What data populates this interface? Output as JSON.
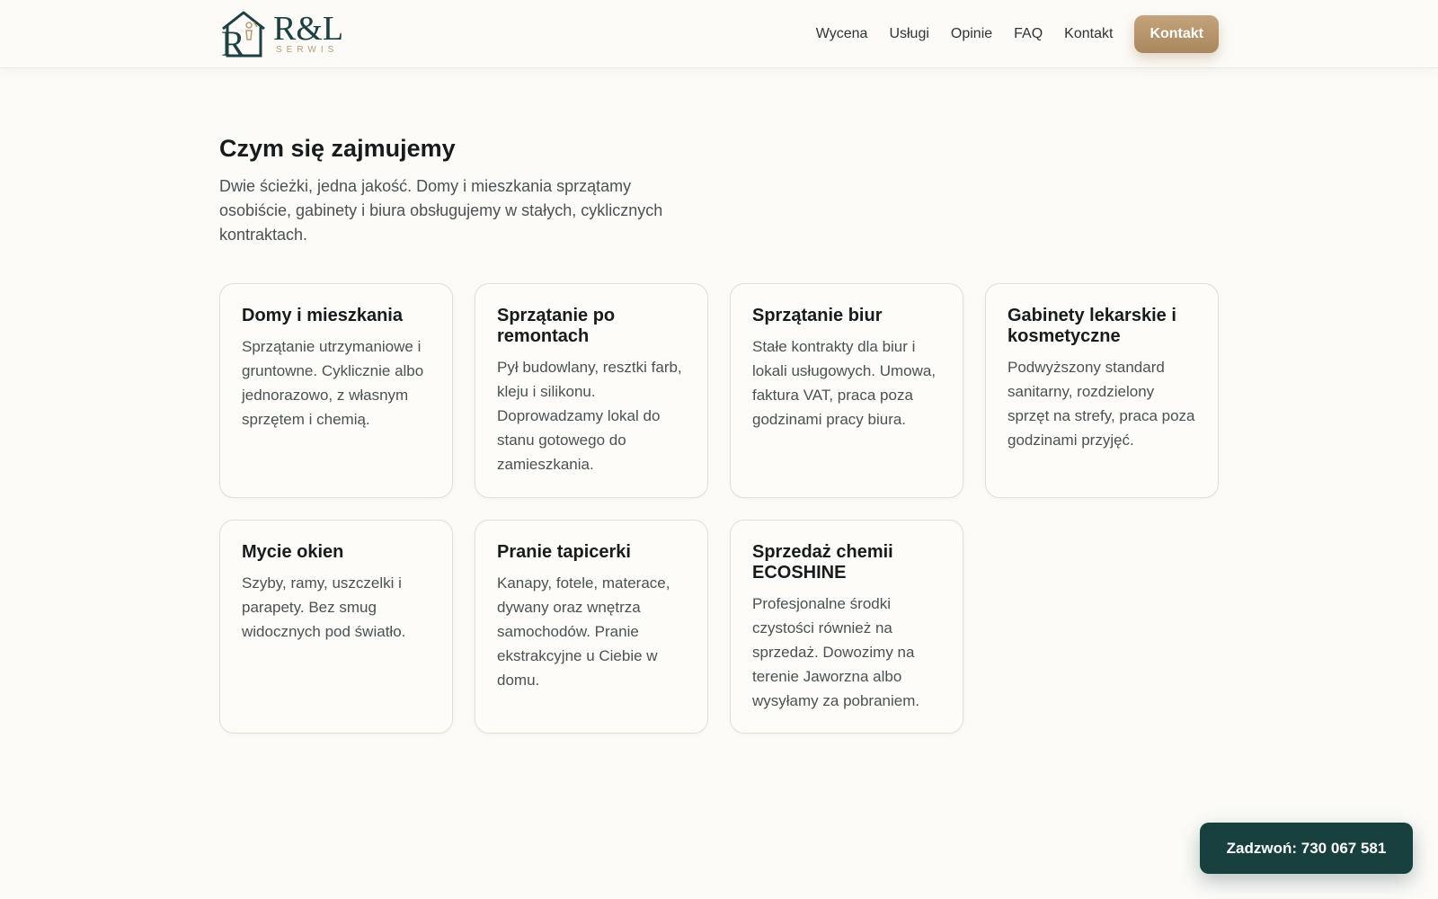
{
  "brand": {
    "name": "R&L",
    "subtitle": "SERWIS",
    "colors": {
      "primary": "#17403f",
      "accent": "#b89a72",
      "background": "#fcfbf8"
    }
  },
  "nav": {
    "links": [
      "Wycena",
      "Usługi",
      "Opinie",
      "FAQ",
      "Kontakt"
    ],
    "cta_label": "Kontakt"
  },
  "services": {
    "title": "Czym się zajmujemy",
    "description": "Dwie ścieżki, jedna jakość. Domy i mieszkania sprzątamy osobiście, gabinety i biura obsługujemy w stałych, cyklicznych kontraktach.",
    "cards": [
      {
        "title": "Domy i mieszkania",
        "text": "Sprzątanie utrzymaniowe i gruntowne. Cyklicznie albo jednorazowo, z własnym sprzętem i chemią."
      },
      {
        "title": "Sprzątanie po remontach",
        "text": "Pył budowlany, resztki farb, kleju i silikonu. Doprowadzamy lokal do stanu gotowego do zamieszkania."
      },
      {
        "title": "Sprzątanie biur",
        "text": "Stałe kontrakty dla biur i lokali usługowych. Umowa, faktura VAT, praca poza godzinami pracy biura."
      },
      {
        "title": "Gabinety lekarskie i kosmetyczne",
        "text": "Podwyższony standard sanitarny, rozdzielony sprzęt na strefy, praca poza godzinami przyjęć."
      },
      {
        "title": "Mycie okien",
        "text": "Szyby, ramy, uszczelki i parapety. Bez smug widocznych pod światło."
      },
      {
        "title": "Pranie tapicerki",
        "text": "Kanapy, fotele, materace, dywany oraz wnętrza samochodów. Pranie ekstrakcyjne u Ciebie w domu."
      },
      {
        "title": "Sprzedaż chemii ECOSHINE",
        "text": "Profesjonalne środki czystości również na sprzedaż. Dowozimy na terenie Jaworzna albo wysyłamy za pobraniem."
      }
    ]
  },
  "call_button": {
    "label": "Zadzwoń: 730 067 581"
  }
}
